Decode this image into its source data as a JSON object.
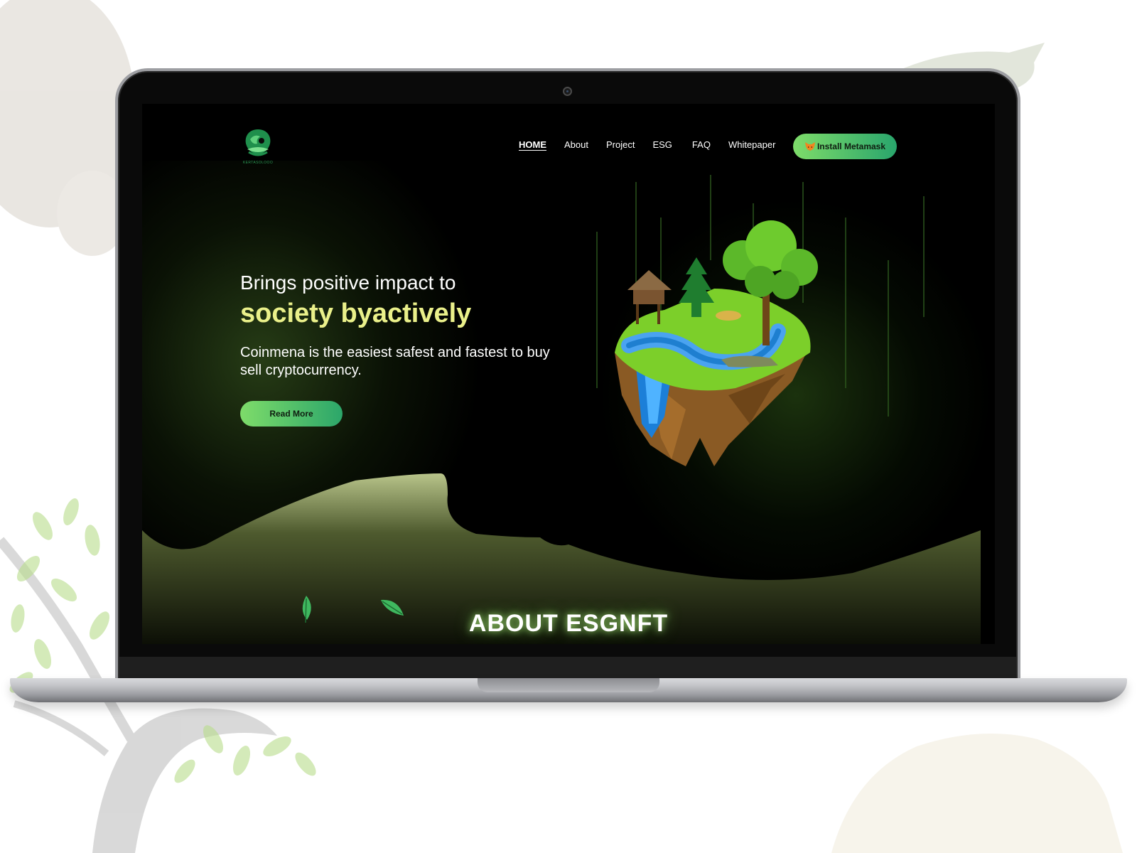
{
  "site": {
    "logo_caption": "KERTASOLOOO",
    "nav": {
      "home": "HOME",
      "about": "About",
      "project": "Project",
      "esg": "ESG",
      "faq": "FAQ",
      "whitepaper": "Whitepaper"
    },
    "metamask_button": "Install Metamask",
    "hero": {
      "title_line1": "Brings positive impact to",
      "title_line2": "society byactively",
      "description": "Coinmena is the easiest safest and fastest to buy sell cryptocurrency.",
      "read_more": "Read More"
    },
    "about_heading": "ABOUT ESGNFT"
  },
  "colors": {
    "accent_yellow": "#eaf08a",
    "button_gradient_start": "#7edc6a",
    "button_gradient_end": "#29a56c",
    "hill": "#b8c48a",
    "background": "#000000"
  },
  "icons": [
    "metamask-fox-icon",
    "brand-logo",
    "leaf-icon"
  ]
}
